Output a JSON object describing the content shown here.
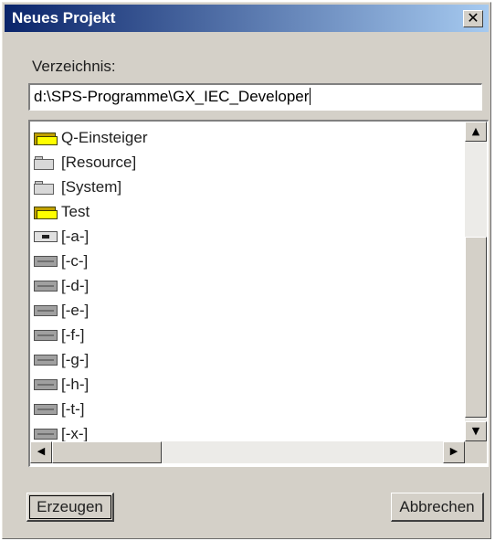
{
  "window": {
    "title": "Neues Projekt",
    "close_glyph": "✕"
  },
  "directory": {
    "label": "Verzeichnis:",
    "path_value": "d:\\SPS-Programme\\GX_IEC_Developer"
  },
  "list": {
    "items": [
      {
        "label": "Q-Einsteiger",
        "icon": "open-folder-icon"
      },
      {
        "label": "[Resource]",
        "icon": "folder-icon"
      },
      {
        "label": "[System]",
        "icon": "folder-icon"
      },
      {
        "label": "Test",
        "icon": "open-folder-icon"
      },
      {
        "label": "[-a-]",
        "icon": "floppy-drive-icon"
      },
      {
        "label": "[-c-]",
        "icon": "hard-drive-icon"
      },
      {
        "label": "[-d-]",
        "icon": "hard-drive-icon"
      },
      {
        "label": "[-e-]",
        "icon": "hard-drive-icon"
      },
      {
        "label": "[-f-]",
        "icon": "hard-drive-icon"
      },
      {
        "label": "[-g-]",
        "icon": "hard-drive-icon"
      },
      {
        "label": "[-h-]",
        "icon": "hard-drive-icon"
      },
      {
        "label": "[-t-]",
        "icon": "hard-drive-icon"
      },
      {
        "label": "[-x-]",
        "icon": "hard-drive-icon"
      }
    ]
  },
  "scrollbars": {
    "up_glyph": "▲",
    "down_glyph": "▼",
    "left_glyph": "◀",
    "right_glyph": "▶"
  },
  "buttons": {
    "create_label": "Erzeugen",
    "cancel_label": "Abbrechen"
  },
  "colors": {
    "titlebar_start": "#0a246a",
    "titlebar_end": "#a6caf0",
    "dialog_face": "#d4d0c8",
    "folder_yellow": "#ffff00"
  }
}
